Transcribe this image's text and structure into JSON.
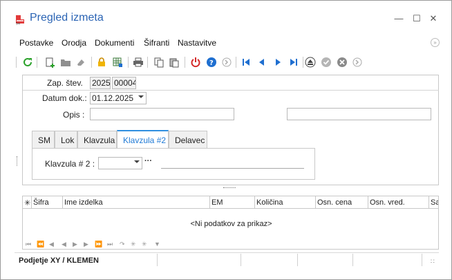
{
  "window": {
    "title": "Pregled izmeta",
    "minimize_glyph": "—",
    "maximize_glyph": "☐",
    "close_glyph": "✕"
  },
  "menu": [
    "Postavke",
    "Orodja",
    "Dokumenti",
    "Šifranti",
    "Nastavitve"
  ],
  "menu_collapse_glyph": "»",
  "toolbar_icons": [
    "refresh-icon",
    "new-document-icon",
    "open-folder-icon",
    "eraser-icon",
    "lock-icon",
    "grid-settings-icon",
    "print-icon",
    "copy-icon",
    "paste-icon",
    "power-icon",
    "help-icon",
    "forward-circle-icon",
    "first-record-icon",
    "previous-record-icon",
    "next-record-icon",
    "last-record-icon",
    "eject-icon",
    "confirm-icon",
    "cancel-icon",
    "forward-small-icon"
  ],
  "form": {
    "zap_label": "Zap. štev.",
    "zap_year": "2025",
    "zap_number": "00004",
    "datum_label": "Datum dok.:",
    "datum_value": "01.12.2025",
    "opis_label": "Opis :",
    "opis_value": "",
    "opis_value2": ""
  },
  "tabs": [
    {
      "label": "SM",
      "active": false
    },
    {
      "label": "Lok",
      "active": false
    },
    {
      "label": "Klavzula",
      "active": false
    },
    {
      "label": "Klavzula #2",
      "active": true
    },
    {
      "label": "Delavec",
      "active": false
    }
  ],
  "tab_panel": {
    "klavzula_label": "Klavzula # 2 :",
    "klavzula_value": "",
    "ellipsis": "···"
  },
  "grid": {
    "columns": [
      "✳",
      "Šifra",
      "Ime izdelka",
      "EM",
      "Količina",
      "Osn. cena",
      "Osn. vred.",
      "Sa"
    ],
    "empty_text": "<Ni podatkov za prikaz>",
    "nav_glyphs": [
      "⏮",
      "⏪",
      "◀",
      "◀",
      "▶",
      "▶",
      "⏩",
      "⏭",
      "↷",
      "✳",
      "✳",
      "▼"
    ]
  },
  "status": {
    "text": "Podjetje  XY / KLEMEN",
    "grip": "∷"
  },
  "colors": {
    "title": "#2b64b4",
    "accent": "#1f7ad6",
    "refresh": "#2aa12a",
    "stop": "#d42b2b",
    "nav": "#1f6fd0"
  }
}
